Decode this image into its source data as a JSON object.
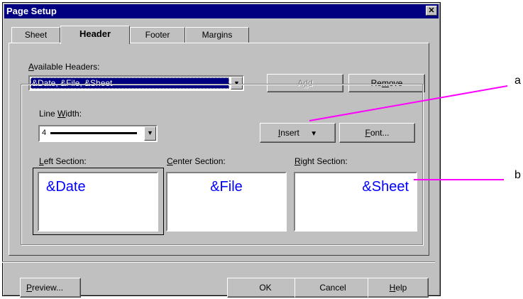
{
  "window": {
    "title": "Page Setup",
    "close_glyph": "✕"
  },
  "tabs": [
    {
      "label": "Sheet",
      "active": false
    },
    {
      "label": "Header",
      "active": true
    },
    {
      "label": "Footer",
      "active": false
    },
    {
      "label": "Margins",
      "active": false
    }
  ],
  "available_headers": {
    "label_prefix": "A",
    "label_rest": "vailable Headers:",
    "value": "&Date, &File, &Sheet"
  },
  "buttons": {
    "add": {
      "prefix": "A",
      "mnemonic": "d",
      "rest": "d"
    },
    "remove": {
      "prefix": "Re",
      "mnemonic": "m",
      "rest": "ove"
    },
    "insert": {
      "prefix": "",
      "mnemonic": "I",
      "rest": "nsert"
    },
    "font": {
      "prefix": "",
      "mnemonic": "F",
      "rest": "ont..."
    },
    "preview": {
      "prefix": "",
      "mnemonic": "P",
      "rest": "review..."
    },
    "ok": "OK",
    "cancel": "Cancel",
    "help": {
      "prefix": "",
      "mnemonic": "H",
      "rest": "elp"
    }
  },
  "line_width": {
    "label_prefix": "Line ",
    "label_mnemonic": "W",
    "label_rest": "idth:",
    "value": "4"
  },
  "sections": {
    "left": {
      "label_prefix": "",
      "label_mnemonic": "L",
      "label_rest": "eft Section:",
      "content": "&Date"
    },
    "center": {
      "label_prefix": "",
      "label_mnemonic": "C",
      "label_rest": "enter Section:",
      "content": "&File"
    },
    "right": {
      "label_prefix": "",
      "label_mnemonic": "R",
      "label_rest": "ight Section:",
      "content": "&Sheet"
    }
  },
  "annotations": {
    "a": "a",
    "b": "b"
  },
  "colors": {
    "titlebar": "#000080",
    "annotation_line": "#ff00ff",
    "section_text": "#0000ff",
    "dialog_bg": "#c0c0c0"
  },
  "icons": {
    "dropdown": "triangle-down",
    "close": "close-x"
  }
}
